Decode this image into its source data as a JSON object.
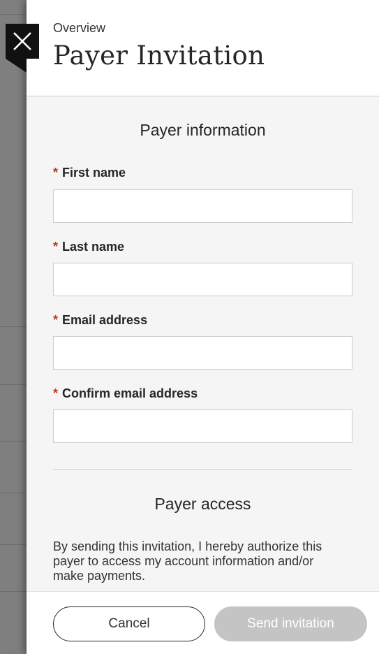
{
  "header": {
    "breadcrumb": "Overview",
    "title": "Payer Invitation",
    "close_icon": "close-icon"
  },
  "payer_information": {
    "title": "Payer information",
    "required_mark": "*",
    "fields": [
      {
        "label": "First name",
        "value": "",
        "placeholder": ""
      },
      {
        "label": "Last name",
        "value": "",
        "placeholder": ""
      },
      {
        "label": "Email address",
        "value": "",
        "placeholder": ""
      },
      {
        "label": "Confirm email address",
        "value": "",
        "placeholder": ""
      }
    ]
  },
  "payer_access": {
    "title": "Payer access",
    "text": "By sending this invitation, I hereby authorize this payer to access my account information and/or make payments."
  },
  "footer": {
    "cancel_label": "Cancel",
    "send_label": "Send invitation"
  },
  "colors": {
    "required": "#c0392b",
    "disabled_button": "#c4c4c4",
    "panel_background": "#f5f5f5"
  }
}
